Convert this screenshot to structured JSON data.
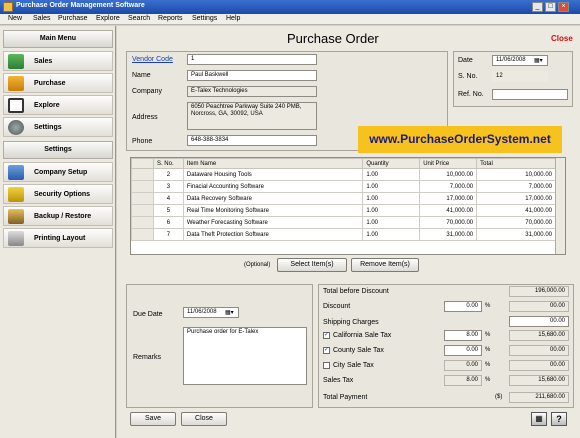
{
  "window": {
    "title": "Purchase Order Management Software",
    "controls": [
      "_",
      "□",
      "×"
    ]
  },
  "menu": [
    "New",
    "Sales",
    "Purchase",
    "Explore",
    "Search",
    "Reports",
    "Settings",
    "Help"
  ],
  "sidebar": {
    "main_menu_title": "Main Menu",
    "main_items": [
      {
        "label": "Sales",
        "icon": "sales-chart-icon"
      },
      {
        "label": "Purchase",
        "icon": "purchase-chart-icon"
      },
      {
        "label": "Explore",
        "icon": "explore-icon"
      },
      {
        "label": "Settings",
        "icon": "gears-icon"
      }
    ],
    "settings_title": "Settings",
    "settings_items": [
      {
        "label": "Company Setup",
        "icon": "company-setup-icon"
      },
      {
        "label": "Security Options",
        "icon": "key-icon"
      },
      {
        "label": "Backup / Restore",
        "icon": "database-icon"
      },
      {
        "label": "Printing Layout",
        "icon": "printer-icon"
      }
    ]
  },
  "form": {
    "title": "Purchase Order",
    "close_label": "Close",
    "vendor_code_label": "Vendor Code",
    "vendor_code": "1",
    "name_label": "Name",
    "name": "Paul Baskwell",
    "company_label": "Company",
    "company": "E-Talex Technologies",
    "address_label": "Address",
    "address": "6050 Peachtree Parkway Suite 240 PMB, Norcross, GA, 30092, USA",
    "phone_label": "Phone",
    "phone": "648-388-3834",
    "date_label": "Date",
    "date": "11/06/2008",
    "sno_label": "S. No.",
    "sno": "12",
    "ref_label": "Ref. No.",
    "ref": "",
    "banner": "www.PurchaseOrderSystem.net"
  },
  "items_table": {
    "columns": [
      "S. No.",
      "Item Name",
      "Quantity",
      "Unit Price",
      "Total"
    ],
    "rows": [
      [
        "",
        "",
        "",
        "",
        ""
      ],
      [
        "2",
        "Dataware Housing Tools",
        "1.00",
        "10,000.00",
        "10,000.00"
      ],
      [
        "3",
        "Finacial Accounting Software",
        "1.00",
        "7,000.00",
        "7,000.00"
      ],
      [
        "4",
        "Data Recovery Software",
        "1.00",
        "17,000.00",
        "17,000.00"
      ],
      [
        "5",
        "Real Time Monitoring Software",
        "1.00",
        "41,000.00",
        "41,000.00"
      ],
      [
        "6",
        "Weather Forecasting Software",
        "1.00",
        "70,000.00",
        "70,000.00"
      ],
      [
        "7",
        "Data Theft Protection Software",
        "1.00",
        "31,000.00",
        "31,000.00"
      ]
    ],
    "optional_label": "(Optional)",
    "select_button": "Select Item(s)",
    "remove_button": "Remove Item(s)"
  },
  "bottom": {
    "due_date_label": "Due Date",
    "due_date": "11/06/2008",
    "remarks_label": "Remarks",
    "remarks": "Purchase order for E-Talex",
    "save_button": "Save",
    "close_button": "Close"
  },
  "totals": {
    "total_before_discount_label": "Total before Discount",
    "total_before_discount": "196,000.00",
    "discount_label": "Discount",
    "discount_pct": "0.00",
    "discount_amount": "00.00",
    "shipping_label": "Shipping Charges",
    "shipping": "00.00",
    "ca_tax_label": "California Sale Tax",
    "ca_tax_pct": "8.00",
    "ca_tax_amount": "15,680.00",
    "county_tax_label": "County Sale Tax",
    "county_tax_pct": "0.00",
    "county_tax_amount": "00.00",
    "city_tax_label": "City Sale Tax",
    "city_tax_pct": "0.00",
    "city_tax_amount": "00.00",
    "sales_tax_label": "Sales Tax",
    "sales_tax_pct": "8.00",
    "sales_tax_amount": "15,680.00",
    "total_payment_label": "Total Payment",
    "currency": "($)",
    "total_payment": "211,680.00",
    "percent": "%",
    "ca_checked": true,
    "county_checked": true,
    "city_checked": false
  }
}
